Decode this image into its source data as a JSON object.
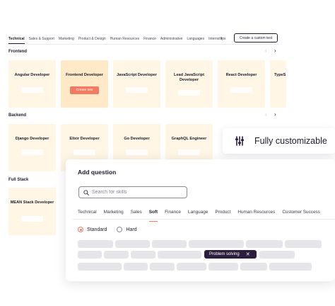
{
  "categories": {
    "tabs": [
      "Technical",
      "Sales & Support",
      "Marketing",
      "Product & Design",
      "Human Resources",
      "Finance",
      "Administrative",
      "Languages",
      "Internships"
    ],
    "more_icon": "chevron-right-icon",
    "create_button": "Create a custom test"
  },
  "sections": {
    "frontend": {
      "title": "Frontend",
      "cards": [
        "Angular Developer",
        "Frontend Developer",
        "JavaScript Developer",
        "Lead JavaScript Developer",
        "React Developer",
        "TypeS"
      ],
      "create_button": "Create test"
    },
    "backend": {
      "title": "Backend",
      "cards": [
        "Django Developer",
        "Elixir Developer",
        "Go Developer",
        "GraphQL Engineer"
      ]
    },
    "fullstack": {
      "title": "Full Stack",
      "cards": [
        "MEAN Stack Developer"
      ]
    }
  },
  "feature_pill": {
    "icon": "sliders-icon",
    "text": "Fully customizable"
  },
  "add_question": {
    "title": "Add question",
    "search_placeholder": "Search for skills",
    "tabs": [
      "Technical",
      "Marketing",
      "Sales",
      "Soft",
      "Finance",
      "Language",
      "Product",
      "Human Resources",
      "Customer Success"
    ],
    "active_tab": "Soft",
    "levels": [
      "Standard",
      "Hard"
    ],
    "selected_level": "Standard",
    "selected_skill": "Problem solving"
  },
  "colors": {
    "accent": "#f37b63",
    "card": "#fff6e5",
    "card_highlight": "#ffe9c6",
    "dark_chip": "#2d1e3f"
  }
}
